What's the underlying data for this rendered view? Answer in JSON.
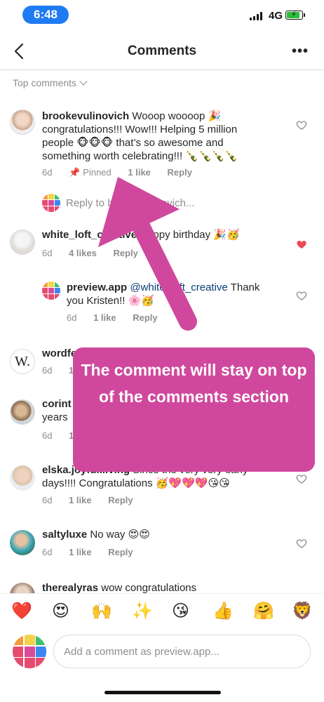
{
  "status_bar": {
    "time": "6:48",
    "network": "4G"
  },
  "nav": {
    "title": "Comments"
  },
  "sort": {
    "label": "Top comments"
  },
  "comments": [
    {
      "username": "brookevulinovich",
      "text": "Wooop woooop 🎉 congratulations!!! Wow!!! Helping 5 million people 🐵🐵🐵 that’s so awesome and something worth celebrating!!! 🍾🍾🍾🍾",
      "time": "6d",
      "pinned": "Pinned",
      "likes": "1 like",
      "reply": "Reply",
      "liked": false
    },
    {
      "username": "white_loft_creative",
      "text": "Happy birthday 🎉🥳",
      "time": "6d",
      "likes": "4 likes",
      "reply": "Reply",
      "liked": true
    },
    {
      "username": "preview.app",
      "mention": "@white_loft_creative",
      "text": "Thank you Kristen!! 🌸🥳",
      "time": "6d",
      "likes": "1 like",
      "reply": "Reply",
      "liked": false
    },
    {
      "username": "wordfe",
      "text": "",
      "time": "6d",
      "likes": "1",
      "reply": "",
      "liked": false
    },
    {
      "username": "corint",
      "text": "years",
      "time": "6d",
      "likes": "1",
      "reply": "",
      "liked": false
    },
    {
      "username": "elska.joyful.living",
      "text": "Since the very very early days!!!! Congratulations 🥳💖💖💖😘😘",
      "time": "6d",
      "likes": "1 like",
      "reply": "Reply",
      "liked": false
    },
    {
      "username": "saltyluxe",
      "text": "No way 😍😍",
      "time": "6d",
      "likes": "1 like",
      "reply": "Reply",
      "liked": false
    },
    {
      "username": "therealyras",
      "text": "wow congratulations",
      "time": "",
      "likes": "",
      "reply": "",
      "liked": false
    }
  ],
  "reply_box": {
    "placeholder": "Reply to brookevulinovich..."
  },
  "callout": {
    "text": "The comment will stay on top of the comments section"
  },
  "emoji_bar": [
    "❤️",
    "😍",
    "🙌",
    "✨",
    "😘",
    "👍",
    "🤗",
    "🦁"
  ],
  "composer": {
    "placeholder": "Add a comment as preview.app..."
  },
  "colors": {
    "accent_pink": "#d0489d",
    "liked_heart": "#ed4956",
    "time_pill": "#1f7bf2"
  }
}
